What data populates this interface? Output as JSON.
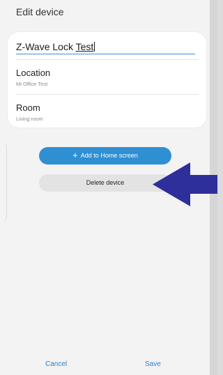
{
  "header": {
    "title": "Edit device"
  },
  "device": {
    "name_prefix": "Z-Wave Lock ",
    "name_underlined": "Test"
  },
  "rows": [
    {
      "label": "Location",
      "value": "Mi Office Test"
    },
    {
      "label": "Room",
      "value": "Living room"
    }
  ],
  "actions": {
    "add_to_home_label": "Add to Home screen",
    "add_icon": "plus-icon",
    "delete_label": "Delete device"
  },
  "annotation": {
    "arrow_color": "#2e2f9a",
    "arrow_icon": "arrow-left-icon"
  },
  "footer": {
    "cancel_label": "Cancel",
    "save_label": "Save"
  },
  "colors": {
    "accent": "#2f8fd3",
    "link": "#2b7fcf",
    "background": "#f3f3f3"
  }
}
